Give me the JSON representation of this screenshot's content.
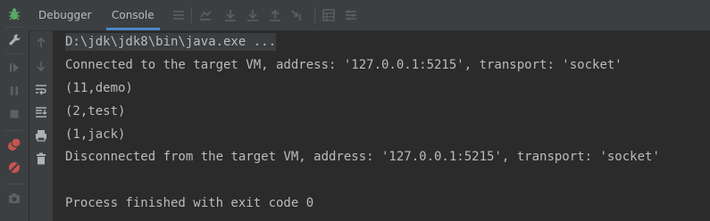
{
  "tabs": [
    {
      "label": "Debugger"
    },
    {
      "label": "Console"
    }
  ],
  "console_lines": [
    "D:\\jdk\\jdk8\\bin\\java.exe ...",
    "Connected to the target VM, address: '127.0.0.1:5215', transport: 'socket'",
    "(11,demo)",
    "(2,test)",
    "(1,jack)",
    "Disconnected from the target VM, address: '127.0.0.1:5215', transport: 'socket'",
    "",
    "Process finished with exit code 0"
  ],
  "colors": {
    "bg": "#2b2b2b",
    "panel": "#3c3f41",
    "text": "#bbbbbb",
    "accent": "#4a88c7",
    "debug_green": "#59a869",
    "breakpoint_red": "#c75450"
  },
  "icons": {
    "left_rail": [
      "debug-bug-icon",
      "wrench-icon",
      "resume-icon",
      "pause-icon",
      "stop-icon",
      "view-breakpoints-icon",
      "mute-breakpoints-icon",
      "camera-icon"
    ],
    "toolbar": [
      "menu-lines-icon",
      "show-execution-point-icon",
      "step-over-icon",
      "step-into-icon",
      "step-out-icon",
      "run-to-cursor-icon",
      "evaluate-icon",
      "layout-settings-icon"
    ],
    "gutter": [
      "up-arrow-icon",
      "down-arrow-icon",
      "soft-wrap-icon",
      "scroll-to-end-icon",
      "print-icon",
      "trash-icon"
    ]
  }
}
